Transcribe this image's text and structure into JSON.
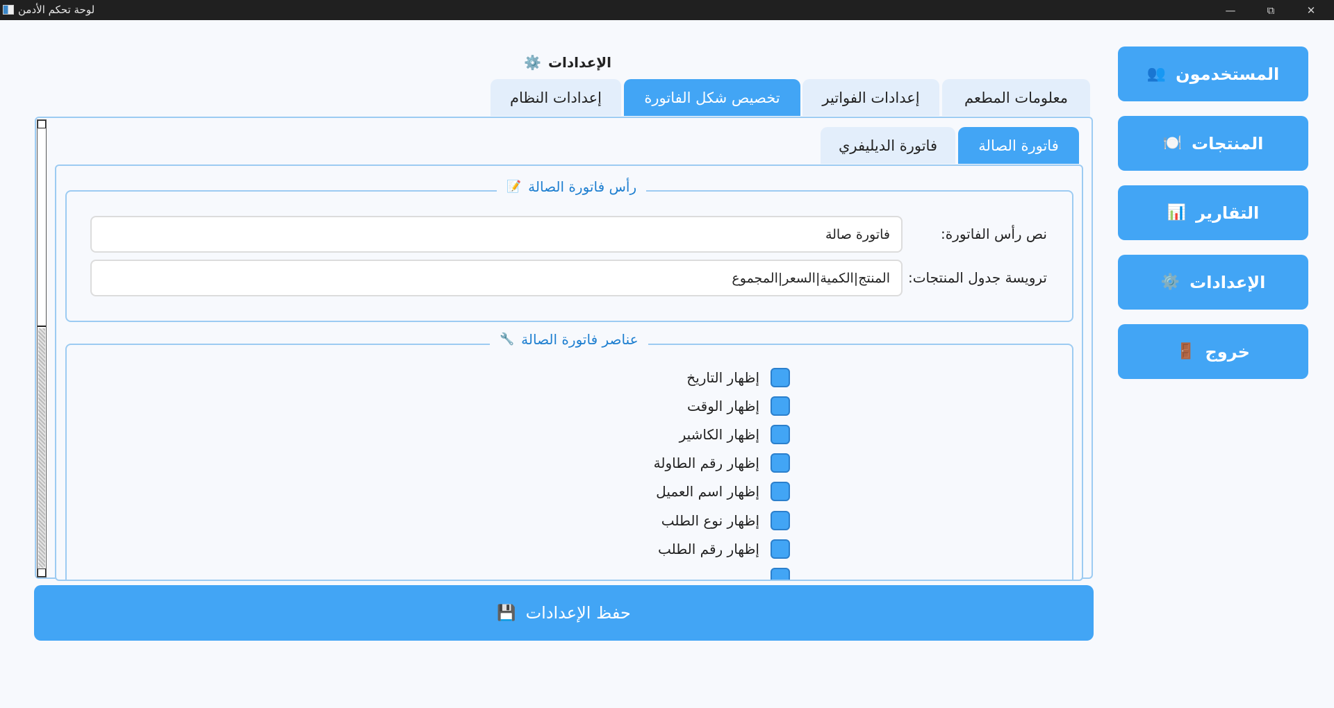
{
  "window": {
    "title": "لوحة تحكم الأدمن",
    "minimize_icon": "minimize-icon",
    "maximize_icon": "restore-icon",
    "close_icon": "close-icon"
  },
  "sidebar": {
    "items": [
      {
        "label": "المستخدمون",
        "icon": "👥"
      },
      {
        "label": "المنتجات",
        "icon": "🍽️"
      },
      {
        "label": "التقارير",
        "icon": "📊"
      },
      {
        "label": "الإعدادات",
        "icon": "⚙️"
      },
      {
        "label": "خروج",
        "icon": "🚪"
      }
    ]
  },
  "page": {
    "title": "الإعدادات",
    "title_icon": "⚙️"
  },
  "tabs": [
    {
      "label": "معلومات المطعم",
      "active": false
    },
    {
      "label": "إعدادات الفواتير",
      "active": false
    },
    {
      "label": "تخصيص شكل الفاتورة",
      "active": true
    },
    {
      "label": "إعدادات النظام",
      "active": false
    }
  ],
  "subtabs": [
    {
      "label": "فاتورة الصالة",
      "active": true
    },
    {
      "label": "فاتورة الديليفري",
      "active": false
    }
  ],
  "header_group": {
    "title": "رأس فاتورة الصالة",
    "icon": "📝",
    "fields": [
      {
        "label": "نص رأس الفاتورة:",
        "value": "فاتورة صالة"
      },
      {
        "label": "ترويسة جدول المنتجات:",
        "value": "المنتج|الكمية|السعر|المجموع"
      }
    ]
  },
  "elements_group": {
    "title": "عناصر فاتورة الصالة",
    "icon": "🔧",
    "checks": [
      {
        "label": "إظهار التاريخ"
      },
      {
        "label": "إظهار الوقت"
      },
      {
        "label": "إظهار الكاشير"
      },
      {
        "label": "إظهار رقم الطاولة"
      },
      {
        "label": "إظهار اسم العميل"
      },
      {
        "label": "إظهار نوع الطلب"
      },
      {
        "label": "إظهار رقم الطلب"
      }
    ]
  },
  "save": {
    "label": "حفظ الإعدادات",
    "icon": "💾"
  },
  "colors": {
    "accent": "#42a5f5",
    "tab_inactive": "#e3eefb",
    "border": "#9ccbf2",
    "group_title": "#1e7fd0"
  }
}
